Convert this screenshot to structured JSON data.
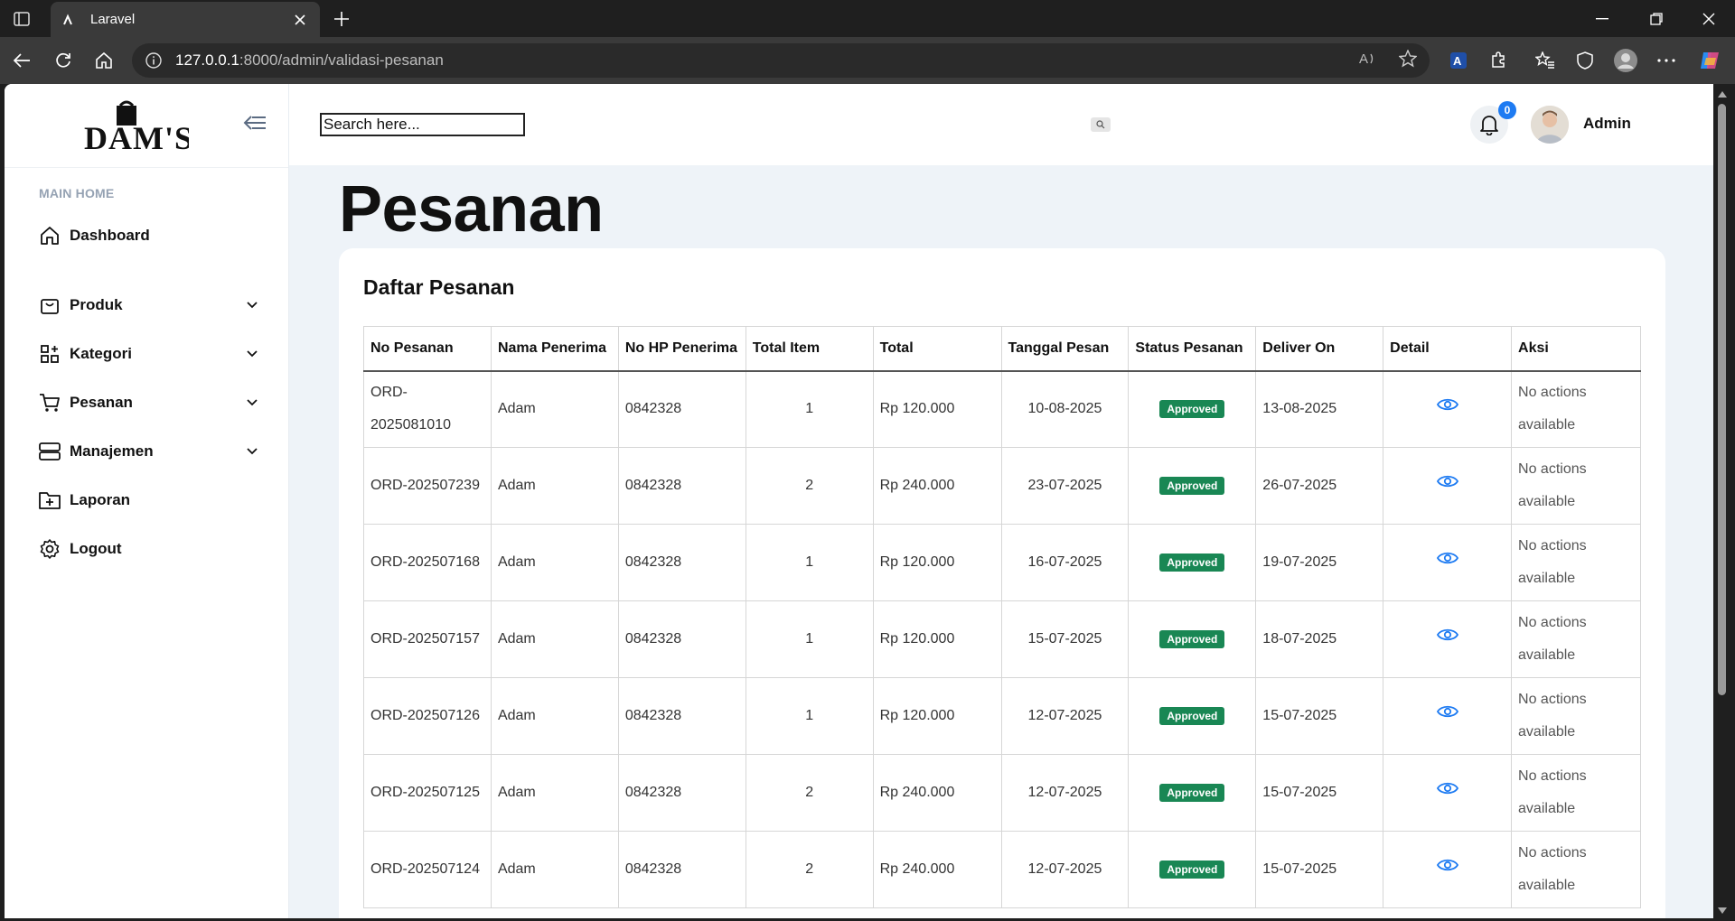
{
  "browser": {
    "tab_title": "Laravel",
    "url_host": "127.0.0.1",
    "url_path": ":8000/admin/validasi-pesanan"
  },
  "brand": {
    "logo_text": "DAM'S"
  },
  "sidebar": {
    "section": "MAIN HOME",
    "items": [
      {
        "label": "Dashboard",
        "icon": "home-icon"
      },
      {
        "label": "Produk",
        "icon": "bag-icon"
      },
      {
        "label": "Kategori",
        "icon": "grid-icon"
      },
      {
        "label": "Pesanan",
        "icon": "cart-icon"
      },
      {
        "label": "Manajemen",
        "icon": "server-icon"
      },
      {
        "label": "Laporan",
        "icon": "folder-plus-icon"
      },
      {
        "label": "Logout",
        "icon": "gear-icon"
      }
    ]
  },
  "header": {
    "search_placeholder": "Search here...",
    "notif_count": "0",
    "user_name": "Admin"
  },
  "page": {
    "title": "Pesanan",
    "card_title": "Daftar Pesanan"
  },
  "table": {
    "columns": [
      "No Pesanan",
      "Nama Penerima",
      "No HP Penerima",
      "Total Item",
      "Total",
      "Tanggal Pesan",
      "Status Pesanan",
      "Deliver On",
      "Detail",
      "Aksi"
    ],
    "rows": [
      {
        "no": "ORD-2025081010",
        "nama": "Adam",
        "hp": "0842328",
        "item": "1",
        "total": "Rp 120.000",
        "tanggal": "10-08-2025",
        "status": "Approved",
        "deliver": "13-08-2025",
        "aksi": "No actions available"
      },
      {
        "no": "ORD-202507239",
        "nama": "Adam",
        "hp": "0842328",
        "item": "2",
        "total": "Rp 240.000",
        "tanggal": "23-07-2025",
        "status": "Approved",
        "deliver": "26-07-2025",
        "aksi": "No actions available"
      },
      {
        "no": "ORD-202507168",
        "nama": "Adam",
        "hp": "0842328",
        "item": "1",
        "total": "Rp 120.000",
        "tanggal": "16-07-2025",
        "status": "Approved",
        "deliver": "19-07-2025",
        "aksi": "No actions available"
      },
      {
        "no": "ORD-202507157",
        "nama": "Adam",
        "hp": "0842328",
        "item": "1",
        "total": "Rp 120.000",
        "tanggal": "15-07-2025",
        "status": "Approved",
        "deliver": "18-07-2025",
        "aksi": "No actions available"
      },
      {
        "no": "ORD-202507126",
        "nama": "Adam",
        "hp": "0842328",
        "item": "1",
        "total": "Rp 120.000",
        "tanggal": "12-07-2025",
        "status": "Approved",
        "deliver": "15-07-2025",
        "aksi": "No actions available"
      },
      {
        "no": "ORD-202507125",
        "nama": "Adam",
        "hp": "0842328",
        "item": "2",
        "total": "Rp 240.000",
        "tanggal": "12-07-2025",
        "status": "Approved",
        "deliver": "15-07-2025",
        "aksi": "No actions available"
      },
      {
        "no": "ORD-202507124",
        "nama": "Adam",
        "hp": "0842328",
        "item": "2",
        "total": "Rp 240.000",
        "tanggal": "12-07-2025",
        "status": "Approved",
        "deliver": "15-07-2025",
        "aksi": "No actions available"
      }
    ]
  },
  "colors": {
    "status_approved": "#198754",
    "link_blue": "#1e7bf2",
    "badge_blue": "#1e7bf2"
  }
}
